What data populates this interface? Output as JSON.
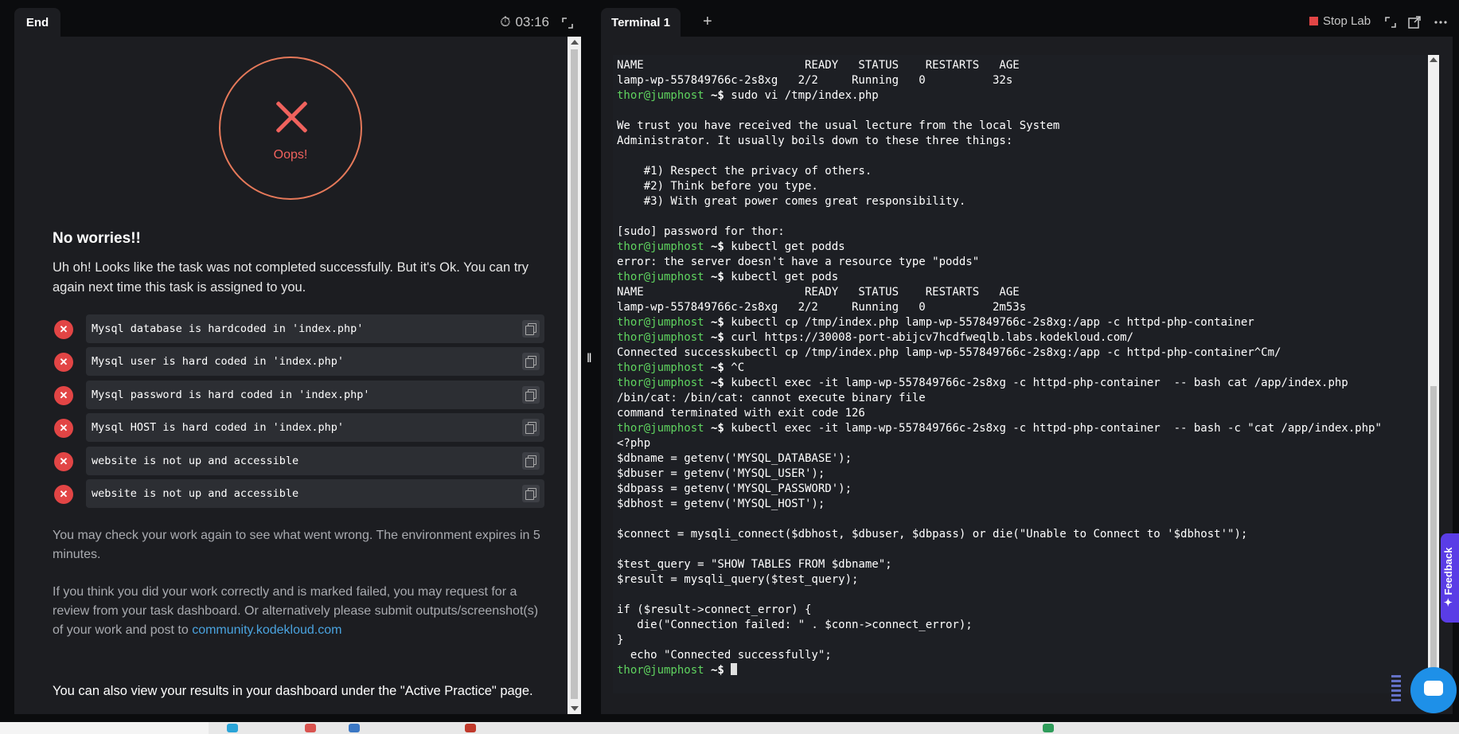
{
  "left_header": {
    "tab_label": "End",
    "timer": "03:16"
  },
  "result": {
    "oops_label": "Oops!",
    "heading": "No worries!!",
    "intro": "Uh oh! Looks like the task was not completed successfully. But it's Ok. You can try again next time this task is assigned to you."
  },
  "checks": [
    {
      "text": "Mysql database is hardcoded in 'index.php'",
      "status": "failed"
    },
    {
      "text": "Mysql user is hard coded in 'index.php'",
      "status": "failed"
    },
    {
      "text": "Mysql password is hard coded in 'index.php'",
      "status": "failed"
    },
    {
      "text": "Mysql HOST is hard coded in 'index.php'",
      "status": "failed"
    },
    {
      "text": "website is not up and accessible",
      "status": "failed"
    },
    {
      "text": "website is not up and accessible",
      "status": "failed"
    }
  ],
  "notes": {
    "recheck": "You may check your work again to see what went wrong. The environment expires in 5 minutes.",
    "review_prefix": "If you think you did your work correctly and is marked failed, you may request for a review from your task dashboard. Or alternatively please submit outputs/screenshot(s) of your work and post to ",
    "review_link": "community.kodekloud.com",
    "dashboard": "You can also view your results in your dashboard under the \"Active Practice\" page."
  },
  "right_header": {
    "terminal_tab": "Terminal 1",
    "add_tab": "+",
    "stop_lab": "Stop Lab"
  },
  "terminal": {
    "prompt_user": "thor@jumphost",
    "prompt_symbol": " ~$ ",
    "lines": [
      {
        "type": "out",
        "text": "NAME                        READY   STATUS    RESTARTS   AGE"
      },
      {
        "type": "out",
        "text": "lamp-wp-557849766c-2s8xg   2/2     Running   0          32s"
      },
      {
        "type": "cmd",
        "text": "sudo vi /tmp/index.php"
      },
      {
        "type": "out",
        "text": ""
      },
      {
        "type": "out",
        "text": "We trust you have received the usual lecture from the local System"
      },
      {
        "type": "out",
        "text": "Administrator. It usually boils down to these three things:"
      },
      {
        "type": "out",
        "text": ""
      },
      {
        "type": "out",
        "text": "    #1) Respect the privacy of others."
      },
      {
        "type": "out",
        "text": "    #2) Think before you type."
      },
      {
        "type": "out",
        "text": "    #3) With great power comes great responsibility."
      },
      {
        "type": "out",
        "text": ""
      },
      {
        "type": "out",
        "text": "[sudo] password for thor:"
      },
      {
        "type": "cmd",
        "text": "kubectl get podds"
      },
      {
        "type": "out",
        "text": "error: the server doesn't have a resource type \"podds\""
      },
      {
        "type": "cmd",
        "text": "kubectl get pods"
      },
      {
        "type": "out",
        "text": "NAME                        READY   STATUS    RESTARTS   AGE"
      },
      {
        "type": "out",
        "text": "lamp-wp-557849766c-2s8xg   2/2     Running   0          2m53s"
      },
      {
        "type": "cmd",
        "text": "kubectl cp /tmp/index.php lamp-wp-557849766c-2s8xg:/app -c httpd-php-container"
      },
      {
        "type": "cmd",
        "text": "curl https://30008-port-abijcv7hcdfweqlb.labs.kodekloud.com/"
      },
      {
        "type": "out",
        "text": "Connected successkubectl cp /tmp/index.php lamp-wp-557849766c-2s8xg:/app -c httpd-php-container^Cm/"
      },
      {
        "type": "cmd",
        "text": "^C"
      },
      {
        "type": "cmd",
        "text": "kubectl exec -it lamp-wp-557849766c-2s8xg -c httpd-php-container  -- bash cat /app/index.php"
      },
      {
        "type": "out",
        "text": "/bin/cat: /bin/cat: cannot execute binary file"
      },
      {
        "type": "out",
        "text": "command terminated with exit code 126"
      },
      {
        "type": "cmd",
        "text": "kubectl exec -it lamp-wp-557849766c-2s8xg -c httpd-php-container  -- bash -c \"cat /app/index.php\""
      },
      {
        "type": "out",
        "text": "<?php"
      },
      {
        "type": "out",
        "text": "$dbname = getenv('MYSQL_DATABASE');"
      },
      {
        "type": "out",
        "text": "$dbuser = getenv('MYSQL_USER');"
      },
      {
        "type": "out",
        "text": "$dbpass = getenv('MYSQL_PASSWORD');"
      },
      {
        "type": "out",
        "text": "$dbhost = getenv('MYSQL_HOST');"
      },
      {
        "type": "out",
        "text": ""
      },
      {
        "type": "out",
        "text": "$connect = mysqli_connect($dbhost, $dbuser, $dbpass) or die(\"Unable to Connect to '$dbhost'\");"
      },
      {
        "type": "out",
        "text": ""
      },
      {
        "type": "out",
        "text": "$test_query = \"SHOW TABLES FROM $dbname\";"
      },
      {
        "type": "out",
        "text": "$result = mysqli_query($test_query);"
      },
      {
        "type": "out",
        "text": ""
      },
      {
        "type": "out",
        "text": "if ($result->connect_error) {"
      },
      {
        "type": "out",
        "text": "   die(\"Connection failed: \" . $conn->connect_error);"
      },
      {
        "type": "out",
        "text": "}"
      },
      {
        "type": "out",
        "text": "  echo \"Connected successfully\";"
      },
      {
        "type": "cursor",
        "text": ""
      }
    ]
  },
  "widgets": {
    "feedback_label": "✦ Feedback"
  },
  "colors": {
    "accent_fail": "#e24545",
    "prompt_green": "#5fd35f",
    "link": "#4aa3df",
    "feedback_purple": "#5a3de6"
  }
}
